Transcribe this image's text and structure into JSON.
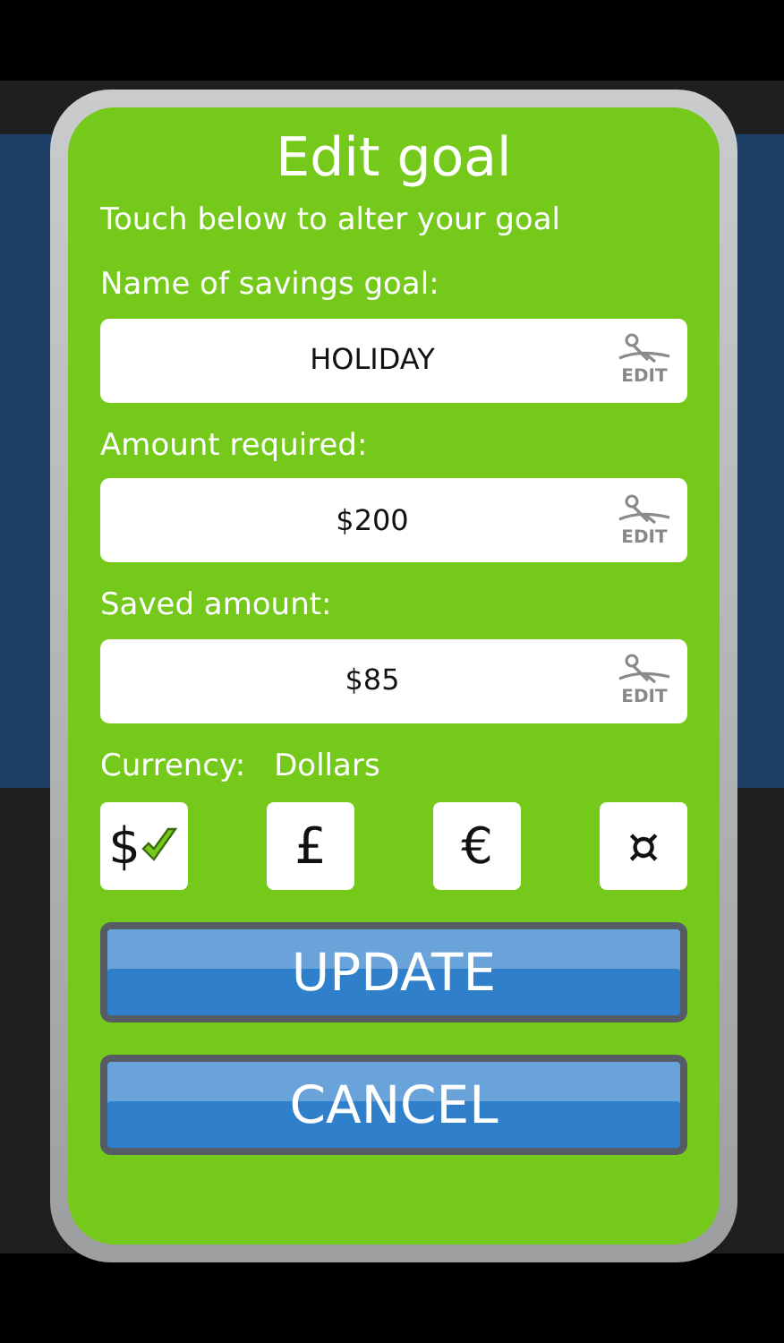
{
  "dialog": {
    "title": "Edit goal",
    "instruction": "Touch below to alter your goal",
    "fields": [
      {
        "label": "Name of savings goal:",
        "value": "HOLIDAY",
        "edit_label": "EDIT"
      },
      {
        "label": "Amount required:",
        "value": "$200",
        "edit_label": "EDIT"
      },
      {
        "label": "Saved amount:",
        "value": "$85",
        "edit_label": "EDIT"
      }
    ],
    "currency": {
      "label": "Currency:",
      "value": "Dollars",
      "options": [
        {
          "symbol": "$",
          "selected": true
        },
        {
          "symbol": "£",
          "selected": false
        },
        {
          "symbol": "€",
          "selected": false
        },
        {
          "symbol": "¤",
          "selected": false
        }
      ]
    },
    "buttons": [
      "UPDATE",
      "CANCEL"
    ]
  }
}
